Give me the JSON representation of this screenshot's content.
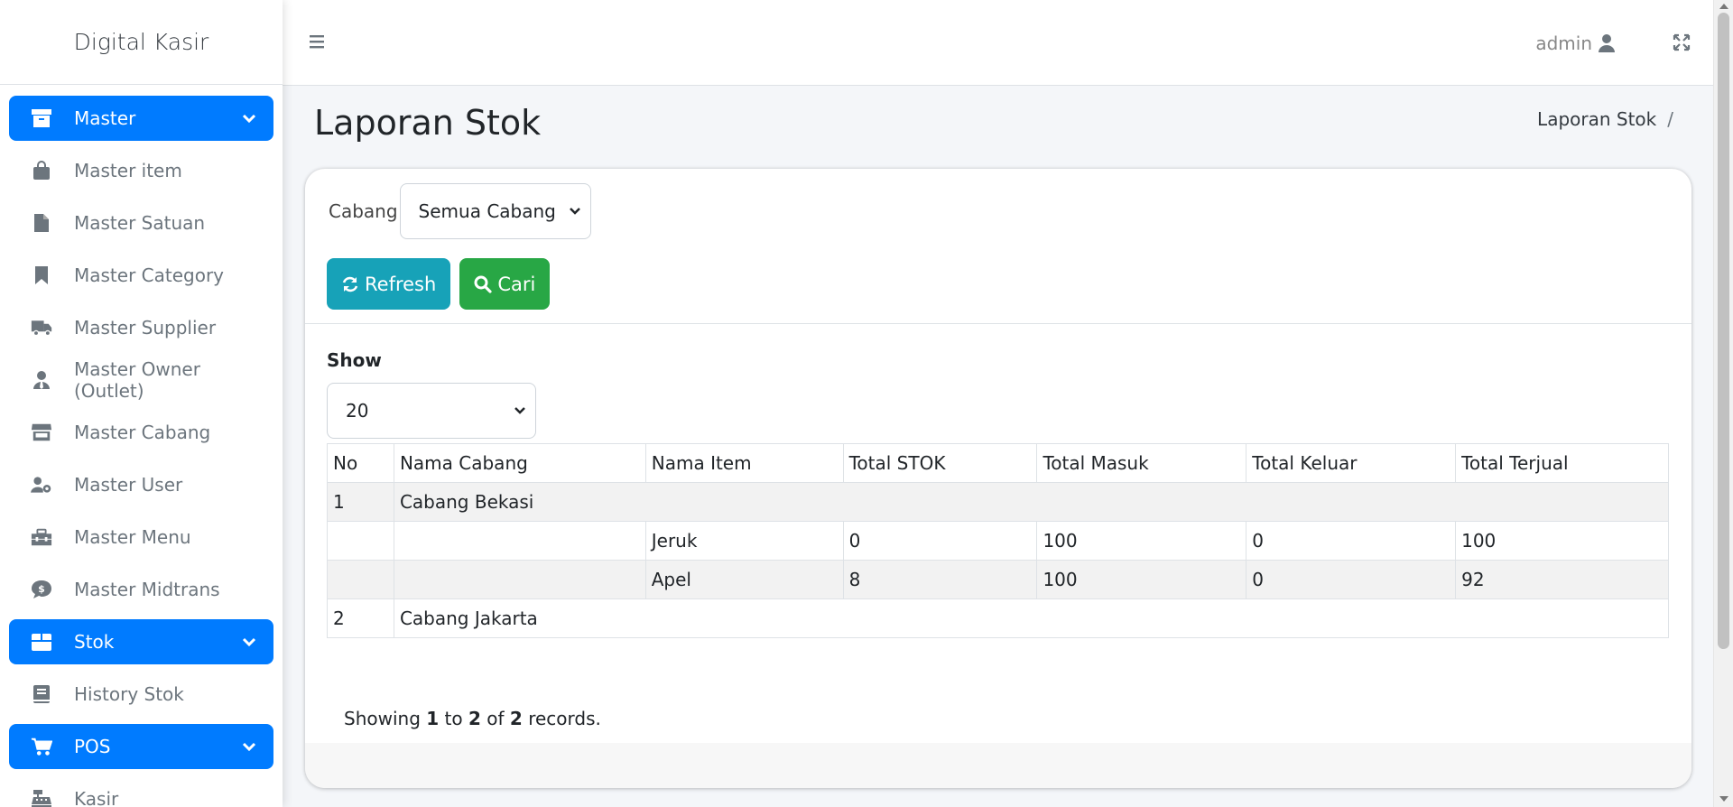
{
  "app": {
    "brand": "Digital Kasir"
  },
  "sidebar": {
    "items": [
      {
        "label": "Master",
        "icon": "archive-icon",
        "active": true,
        "group": true
      },
      {
        "label": "Master item",
        "icon": "shopping-bag-icon"
      },
      {
        "label": "Master Satuan",
        "icon": "file-icon"
      },
      {
        "label": "Master Category",
        "icon": "bookmark-icon"
      },
      {
        "label": "Master Supplier",
        "icon": "truck-icon"
      },
      {
        "label": "Master Owner (Outlet)",
        "icon": "user-tie-icon"
      },
      {
        "label": "Master Cabang",
        "icon": "store-icon"
      },
      {
        "label": "Master User",
        "icon": "user-cog-icon"
      },
      {
        "label": "Master Menu",
        "icon": "toolbox-icon"
      },
      {
        "label": "Master Midtrans",
        "icon": "dollar-comment-icon"
      },
      {
        "label": "Stok",
        "icon": "box-open-icon",
        "active": true,
        "group": true
      },
      {
        "label": "History Stok",
        "icon": "book-icon"
      },
      {
        "label": "POS",
        "icon": "cart-icon",
        "active": true,
        "group": true
      },
      {
        "label": "Kasir",
        "icon": "cash-register-icon"
      }
    ]
  },
  "topbar": {
    "user": "admin"
  },
  "page": {
    "title": "Laporan Stok",
    "breadcrumb": "Laporan Stok",
    "breadcrumb_sep": "/"
  },
  "filter": {
    "cabang_label": "Cabang",
    "cabang_value": "Semua Cabang",
    "refresh_label": "Refresh",
    "cari_label": "Cari"
  },
  "list": {
    "show_label": "Show",
    "show_value": "20",
    "columns": [
      "No",
      "Nama Cabang",
      "Nama Item",
      "Total STOK",
      "Total Masuk",
      "Total Keluar",
      "Total Terjual"
    ],
    "rows": [
      {
        "no": "1",
        "cabang": "Cabang Bekasi"
      },
      {
        "item": "Jeruk",
        "stok": "0",
        "masuk": "100",
        "keluar": "0",
        "terjual": "100"
      },
      {
        "item": "Apel",
        "stok": "8",
        "masuk": "100",
        "keluar": "0",
        "terjual": "92"
      },
      {
        "no": "2",
        "cabang": "Cabang Jakarta"
      }
    ],
    "info": {
      "prefix": "Showing",
      "from": "1",
      "to_word": "to",
      "to": "2",
      "of_word": "of",
      "total": "2",
      "suffix": "records."
    }
  },
  "colors": {
    "primary": "#007bff",
    "info": "#17a2b8",
    "success": "#28a745"
  }
}
